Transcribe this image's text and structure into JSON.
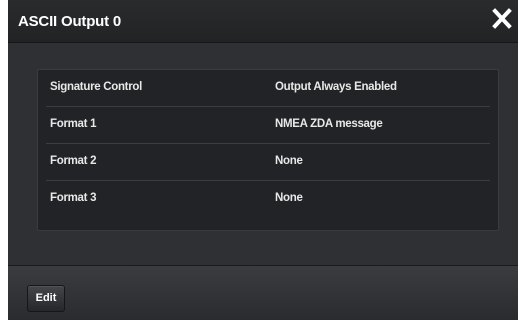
{
  "dialog": {
    "title": "ASCII Output 0",
    "close_icon": "close-icon"
  },
  "settings": {
    "rows": [
      {
        "label": "Signature Control",
        "value": "Output Always Enabled"
      },
      {
        "label": "Format 1",
        "value": "NMEA ZDA message"
      },
      {
        "label": "Format 2",
        "value": "None"
      },
      {
        "label": "Format 3",
        "value": "None"
      }
    ]
  },
  "footer": {
    "edit_label": "Edit"
  },
  "colors": {
    "background": "#2f3033",
    "panel": "#222326",
    "text": "#e8e8e8"
  }
}
